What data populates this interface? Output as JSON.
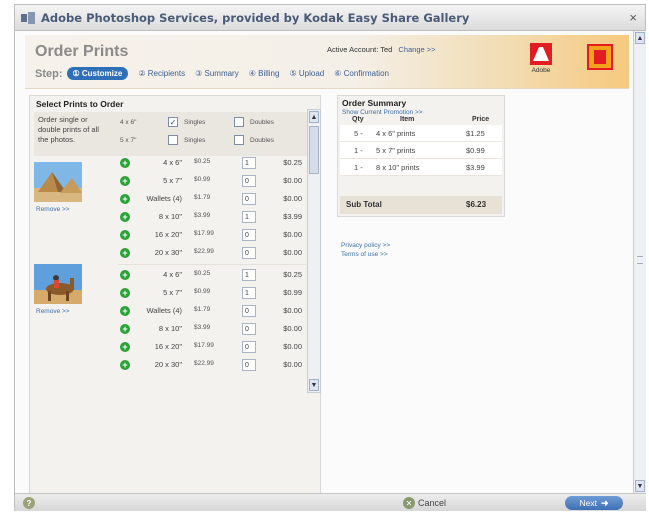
{
  "window": {
    "title": "Adobe Photoshop Services, provided by Kodak Easy Share Gallery",
    "close_glyph": "×"
  },
  "header": {
    "title": "Order Prints",
    "step_label": "Step:",
    "steps": [
      "① Customize",
      "② Recipients",
      "③ Summary",
      "④ Billing",
      "⑤ Upload",
      "⑥ Confirmation"
    ],
    "account_label": "Active Account: Ted",
    "change_link": "Change >>",
    "adobe_word": "Adobe"
  },
  "select_prints": {
    "title": "Select Prints to Order",
    "description": "Order single or double prints of all the photos.",
    "options": [
      {
        "size": "4 x 6\"",
        "singles": "Singles",
        "doubles": "Doubles",
        "singles_checked": true
      },
      {
        "size": "5 x 7\"",
        "singles": "Singles",
        "doubles": "Doubles",
        "singles_checked": false
      }
    ],
    "checkmark": "✓",
    "remove_label": "Remove >>",
    "photos": [
      {
        "subject": "pyramids",
        "rows": [
          {
            "size": "4 x 6\"",
            "price": "$0.25",
            "qty": "1",
            "total": "$0.25"
          },
          {
            "size": "5 x 7\"",
            "price": "$0.99",
            "qty": "0",
            "total": "$0.00"
          },
          {
            "size": "Wallets (4)",
            "price": "$1.79",
            "qty": "0",
            "total": "$0.00"
          },
          {
            "size": "8 x 10\"",
            "price": "$3.99",
            "qty": "1",
            "total": "$3.99"
          },
          {
            "size": "16 x 20\"",
            "price": "$17.99",
            "qty": "0",
            "total": "$0.00"
          },
          {
            "size": "20 x 30\"",
            "price": "$22.99",
            "qty": "0",
            "total": "$0.00"
          }
        ]
      },
      {
        "subject": "camel",
        "rows": [
          {
            "size": "4 x 6\"",
            "price": "$0.25",
            "qty": "1",
            "total": "$0.25"
          },
          {
            "size": "5 x 7\"",
            "price": "$0.99",
            "qty": "1",
            "total": "$0.99"
          },
          {
            "size": "Wallets (4)",
            "price": "$1.79",
            "qty": "0",
            "total": "$0.00"
          },
          {
            "size": "8 x 10\"",
            "price": "$3.99",
            "qty": "0",
            "total": "$0.00"
          },
          {
            "size": "16 x 20\"",
            "price": "$17.99",
            "qty": "0",
            "total": "$0.00"
          },
          {
            "size": "20 x 30\"",
            "price": "$22.99",
            "qty": "0",
            "total": "$0.00"
          }
        ]
      }
    ]
  },
  "order_summary": {
    "title": "Order Summary",
    "promo_link": "Show Current Promotion >>",
    "headers": {
      "qty": "Qty",
      "item": "Item",
      "price": "Price"
    },
    "items": [
      {
        "qty": "5 -",
        "item": "4 x 6\" prints",
        "price": "$1.25"
      },
      {
        "qty": "1 -",
        "item": "5 x 7\" prints",
        "price": "$0.99"
      },
      {
        "qty": "1 -",
        "item": "8 x 10\" prints",
        "price": "$3.99"
      }
    ],
    "subtotal_label": "Sub Total",
    "subtotal_value": "$6.23"
  },
  "links": {
    "privacy": "Privacy policy >>",
    "terms": "Terms of use >>"
  },
  "footer": {
    "help_glyph": "?",
    "cancel": "Cancel",
    "next": "Next",
    "next_arrow": "➜"
  },
  "icons": {
    "plus": "+",
    "scroll_up": "▲",
    "scroll_down": "▼"
  },
  "colors": {
    "accent_blue": "#2f6fb8",
    "link_blue": "#3d6fb0",
    "add_green": "#2aa238",
    "adobe_red": "#e31b23",
    "kodak_yellow": "#f4a31c"
  }
}
